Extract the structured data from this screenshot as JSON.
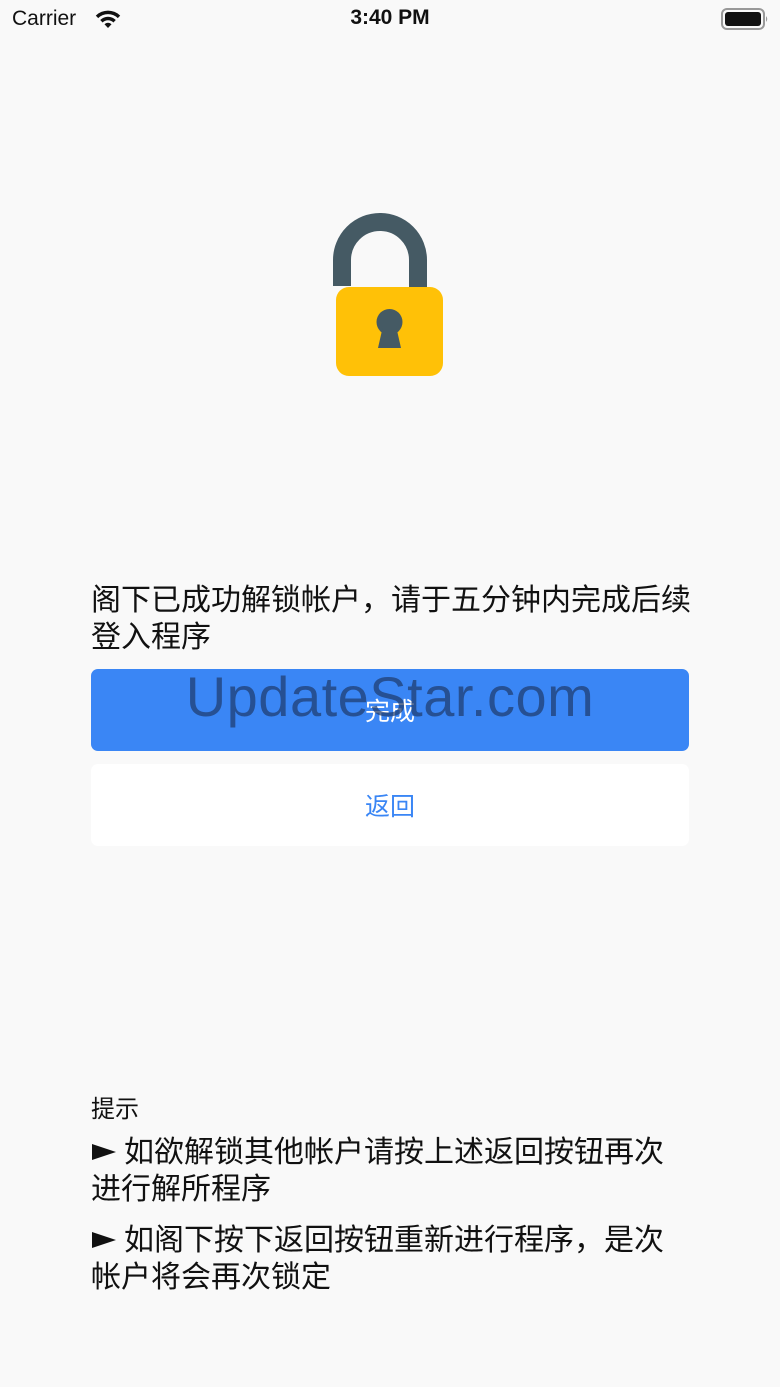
{
  "status_bar": {
    "carrier": "Carrier",
    "time": "3:40 PM",
    "icons": [
      "wifi-icon",
      "battery-icon"
    ]
  },
  "lock": {
    "icon": "unlocked-padlock-icon",
    "colors": {
      "shackle": "#455a64",
      "body": "#ffc107",
      "keyhole": "#455a64"
    }
  },
  "message": "阁下已成功解锁帐户，请于五分钟内完成后续登入程序",
  "buttons": {
    "done_label": "完成",
    "back_label": "返回"
  },
  "watermark": "UpdateStar.com",
  "tips": {
    "title": "提示",
    "items": [
      "如欲解锁其他帐户请按上述返回按钮再次进行解所程序",
      "如阁下按下返回按钮重新进行程序，是次帐户将会再次锁定"
    ],
    "bullet_icon": "right-triangle-bullet-icon"
  },
  "colors": {
    "accent": "#3a86f5",
    "background": "#f9f9f9"
  }
}
